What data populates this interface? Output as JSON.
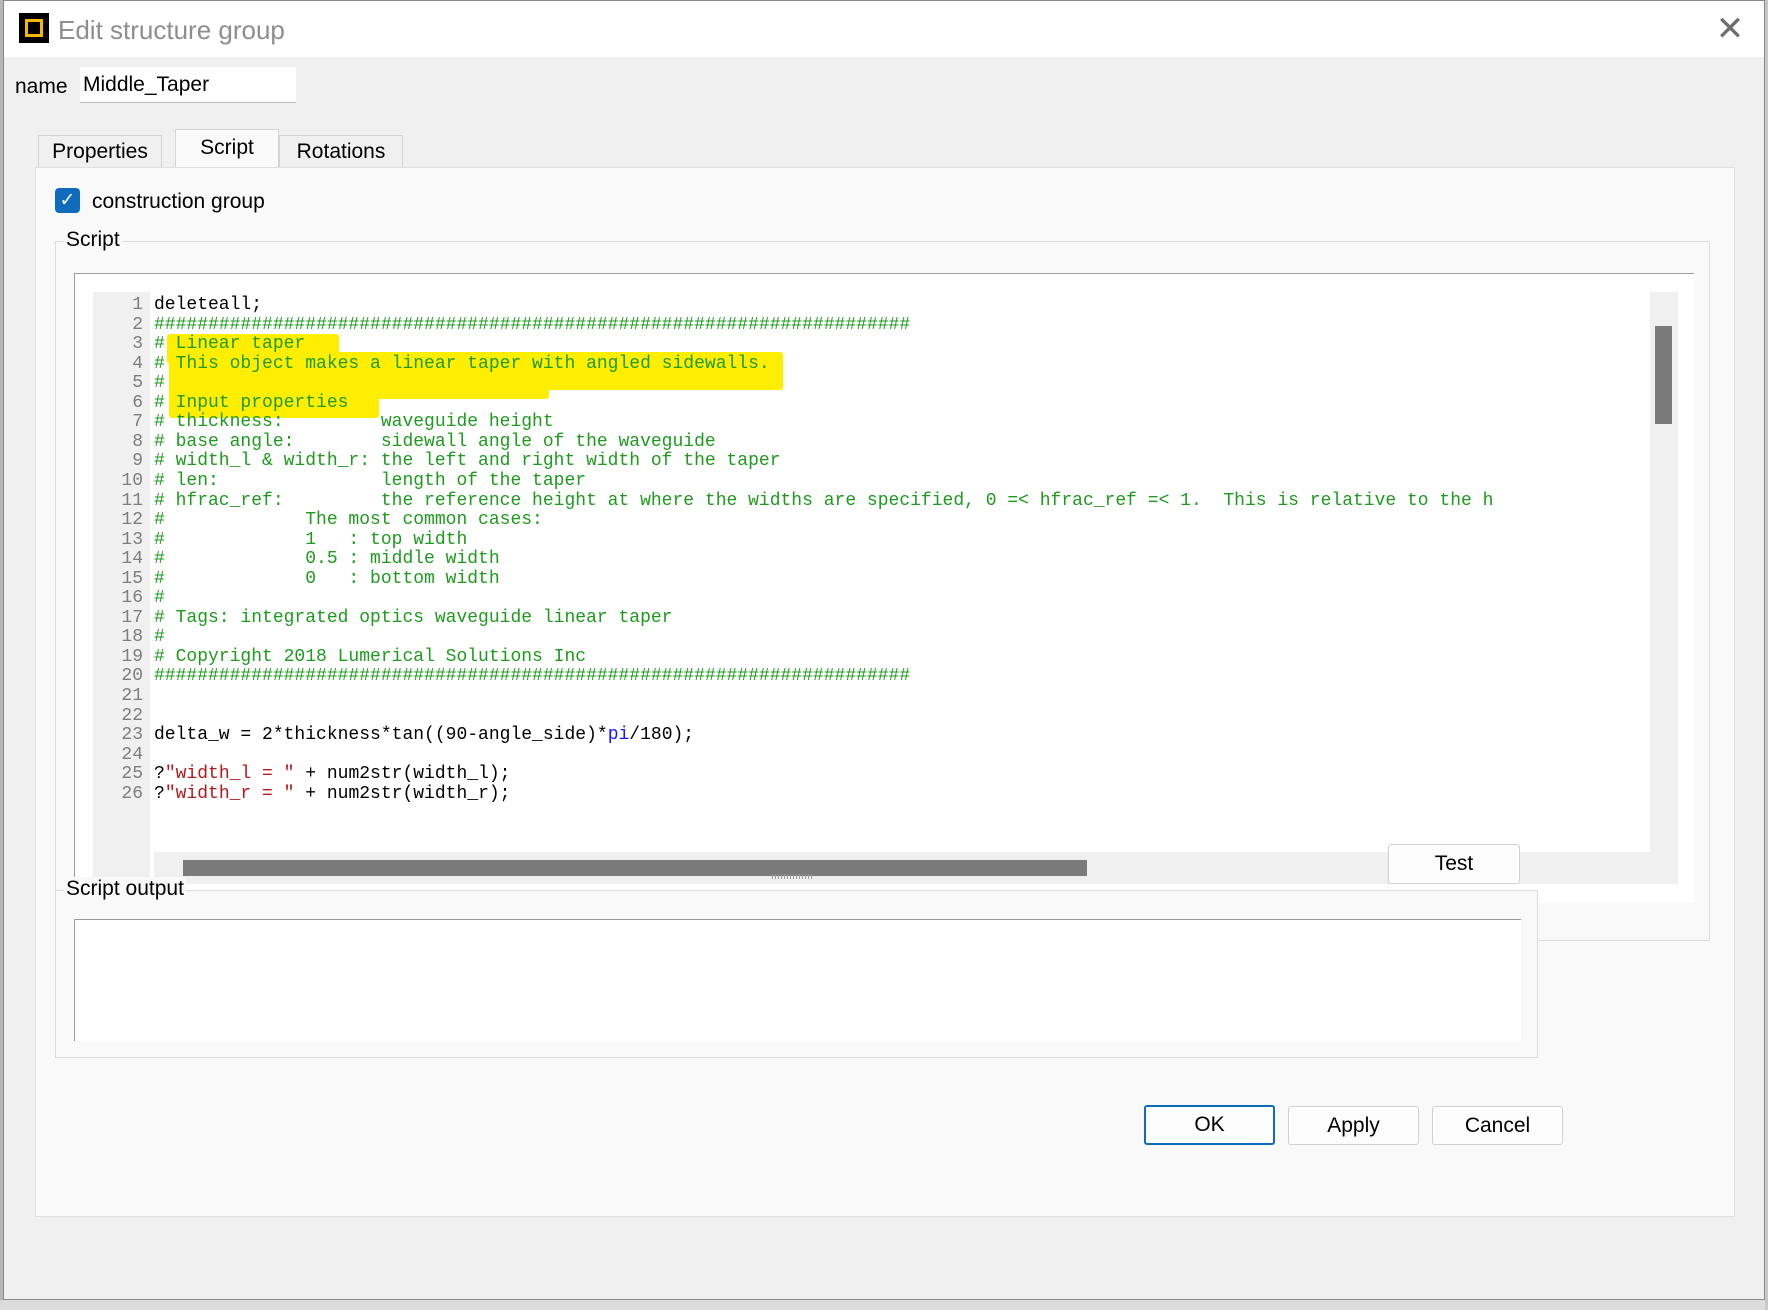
{
  "window": {
    "title": "Edit structure group",
    "close_glyph": "✕",
    "icon": "app-icon"
  },
  "name_field": {
    "label": "name",
    "value": "Middle_Taper"
  },
  "tabs": [
    {
      "label": "Properties",
      "active": false
    },
    {
      "label": "Script",
      "active": true
    },
    {
      "label": "Rotations",
      "active": false
    }
  ],
  "construction_group": {
    "label": "construction group",
    "checked": true,
    "check_glyph": "✓"
  },
  "script_group": {
    "title": "Script"
  },
  "code_lines": [
    [
      {
        "t": "deleteall;",
        "c": "norm"
      }
    ],
    [
      {
        "t": "######################################################################",
        "c": "com"
      }
    ],
    [
      {
        "t": "# Linear taper",
        "c": "com"
      }
    ],
    [
      {
        "t": "# This object makes a linear taper with angled sidewalls.",
        "c": "com"
      }
    ],
    [
      {
        "t": "#",
        "c": "com"
      }
    ],
    [
      {
        "t": "# Input properties",
        "c": "com"
      }
    ],
    [
      {
        "t": "# thickness:         waveguide height",
        "c": "com"
      }
    ],
    [
      {
        "t": "# base angle:        sidewall angle of the waveguide",
        "c": "com"
      }
    ],
    [
      {
        "t": "# width_l & width_r: the left and right width of the taper",
        "c": "com"
      }
    ],
    [
      {
        "t": "# len:               length of the taper",
        "c": "com"
      }
    ],
    [
      {
        "t": "# hfrac_ref:         the reference height at where the widths are specified, 0 =< hfrac_ref =< 1.  This is relative to the h",
        "c": "com"
      }
    ],
    [
      {
        "t": "#             The most common cases:",
        "c": "com"
      }
    ],
    [
      {
        "t": "#             1   : top width",
        "c": "com"
      }
    ],
    [
      {
        "t": "#             0.5 : middle width",
        "c": "com"
      }
    ],
    [
      {
        "t": "#             0   : bottom width",
        "c": "com"
      }
    ],
    [
      {
        "t": "#",
        "c": "com"
      }
    ],
    [
      {
        "t": "# Tags: integrated optics waveguide linear taper",
        "c": "com"
      }
    ],
    [
      {
        "t": "#",
        "c": "com"
      }
    ],
    [
      {
        "t": "# Copyright 2018 Lumerical Solutions Inc",
        "c": "com"
      }
    ],
    [
      {
        "t": "######################################################################",
        "c": "com"
      }
    ],
    [],
    [],
    [
      {
        "t": "delta_w = 2*thickness*tan((90-angle_side)*",
        "c": "norm"
      },
      {
        "t": "pi",
        "c": "kw"
      },
      {
        "t": "/180);",
        "c": "norm"
      }
    ],
    [],
    [
      {
        "t": "?",
        "c": "norm"
      },
      {
        "t": "\"width_l = \"",
        "c": "str"
      },
      {
        "t": " + num2str(width_l);",
        "c": "norm"
      }
    ],
    [
      {
        "t": "?",
        "c": "norm"
      },
      {
        "t": "\"width_r = \"",
        "c": "str"
      },
      {
        "t": " + num2str(width_r);",
        "c": "norm"
      }
    ]
  ],
  "test_button": "Test",
  "output_group": {
    "title": "Script output",
    "content": ""
  },
  "footer": {
    "ok": "OK",
    "apply": "Apply",
    "cancel": "Cancel"
  },
  "colors": {
    "accent": "#0f6cbd",
    "comment": "#1f9a1f",
    "string": "#b31b1b",
    "keyword": "#1a1aff",
    "highlight": "#ffee00"
  }
}
